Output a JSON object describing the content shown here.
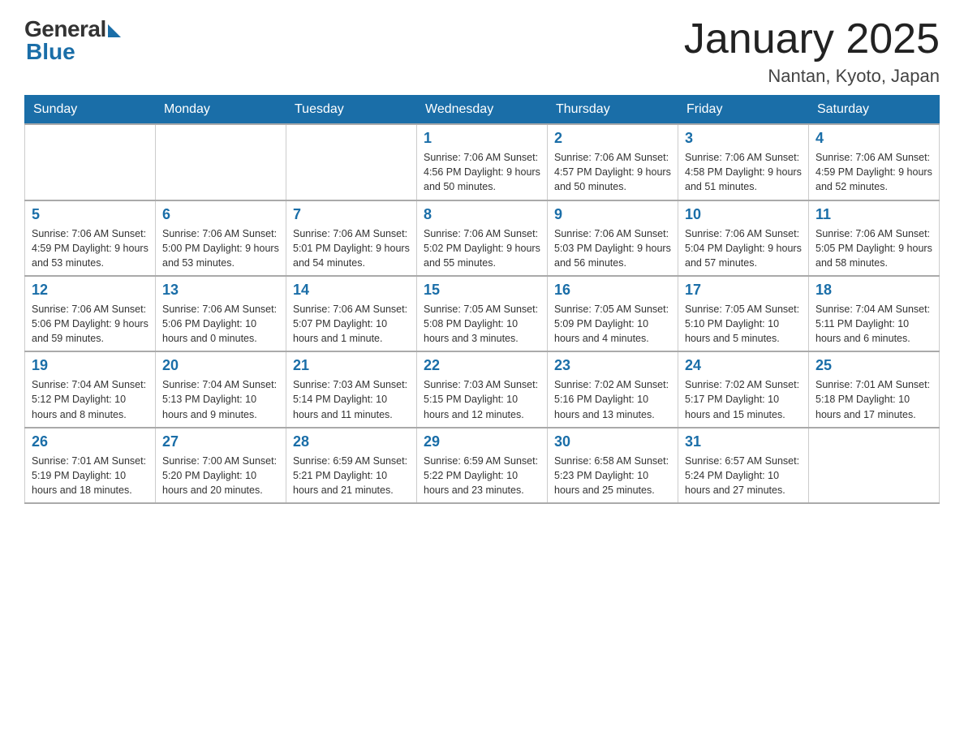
{
  "logo": {
    "general": "General",
    "blue": "Blue"
  },
  "header": {
    "month": "January 2025",
    "location": "Nantan, Kyoto, Japan"
  },
  "days_of_week": [
    "Sunday",
    "Monday",
    "Tuesday",
    "Wednesday",
    "Thursday",
    "Friday",
    "Saturday"
  ],
  "weeks": [
    [
      {
        "day": "",
        "info": ""
      },
      {
        "day": "",
        "info": ""
      },
      {
        "day": "",
        "info": ""
      },
      {
        "day": "1",
        "info": "Sunrise: 7:06 AM\nSunset: 4:56 PM\nDaylight: 9 hours\nand 50 minutes."
      },
      {
        "day": "2",
        "info": "Sunrise: 7:06 AM\nSunset: 4:57 PM\nDaylight: 9 hours\nand 50 minutes."
      },
      {
        "day": "3",
        "info": "Sunrise: 7:06 AM\nSunset: 4:58 PM\nDaylight: 9 hours\nand 51 minutes."
      },
      {
        "day": "4",
        "info": "Sunrise: 7:06 AM\nSunset: 4:59 PM\nDaylight: 9 hours\nand 52 minutes."
      }
    ],
    [
      {
        "day": "5",
        "info": "Sunrise: 7:06 AM\nSunset: 4:59 PM\nDaylight: 9 hours\nand 53 minutes."
      },
      {
        "day": "6",
        "info": "Sunrise: 7:06 AM\nSunset: 5:00 PM\nDaylight: 9 hours\nand 53 minutes."
      },
      {
        "day": "7",
        "info": "Sunrise: 7:06 AM\nSunset: 5:01 PM\nDaylight: 9 hours\nand 54 minutes."
      },
      {
        "day": "8",
        "info": "Sunrise: 7:06 AM\nSunset: 5:02 PM\nDaylight: 9 hours\nand 55 minutes."
      },
      {
        "day": "9",
        "info": "Sunrise: 7:06 AM\nSunset: 5:03 PM\nDaylight: 9 hours\nand 56 minutes."
      },
      {
        "day": "10",
        "info": "Sunrise: 7:06 AM\nSunset: 5:04 PM\nDaylight: 9 hours\nand 57 minutes."
      },
      {
        "day": "11",
        "info": "Sunrise: 7:06 AM\nSunset: 5:05 PM\nDaylight: 9 hours\nand 58 minutes."
      }
    ],
    [
      {
        "day": "12",
        "info": "Sunrise: 7:06 AM\nSunset: 5:06 PM\nDaylight: 9 hours\nand 59 minutes."
      },
      {
        "day": "13",
        "info": "Sunrise: 7:06 AM\nSunset: 5:06 PM\nDaylight: 10 hours\nand 0 minutes."
      },
      {
        "day": "14",
        "info": "Sunrise: 7:06 AM\nSunset: 5:07 PM\nDaylight: 10 hours\nand 1 minute."
      },
      {
        "day": "15",
        "info": "Sunrise: 7:05 AM\nSunset: 5:08 PM\nDaylight: 10 hours\nand 3 minutes."
      },
      {
        "day": "16",
        "info": "Sunrise: 7:05 AM\nSunset: 5:09 PM\nDaylight: 10 hours\nand 4 minutes."
      },
      {
        "day": "17",
        "info": "Sunrise: 7:05 AM\nSunset: 5:10 PM\nDaylight: 10 hours\nand 5 minutes."
      },
      {
        "day": "18",
        "info": "Sunrise: 7:04 AM\nSunset: 5:11 PM\nDaylight: 10 hours\nand 6 minutes."
      }
    ],
    [
      {
        "day": "19",
        "info": "Sunrise: 7:04 AM\nSunset: 5:12 PM\nDaylight: 10 hours\nand 8 minutes."
      },
      {
        "day": "20",
        "info": "Sunrise: 7:04 AM\nSunset: 5:13 PM\nDaylight: 10 hours\nand 9 minutes."
      },
      {
        "day": "21",
        "info": "Sunrise: 7:03 AM\nSunset: 5:14 PM\nDaylight: 10 hours\nand 11 minutes."
      },
      {
        "day": "22",
        "info": "Sunrise: 7:03 AM\nSunset: 5:15 PM\nDaylight: 10 hours\nand 12 minutes."
      },
      {
        "day": "23",
        "info": "Sunrise: 7:02 AM\nSunset: 5:16 PM\nDaylight: 10 hours\nand 13 minutes."
      },
      {
        "day": "24",
        "info": "Sunrise: 7:02 AM\nSunset: 5:17 PM\nDaylight: 10 hours\nand 15 minutes."
      },
      {
        "day": "25",
        "info": "Sunrise: 7:01 AM\nSunset: 5:18 PM\nDaylight: 10 hours\nand 17 minutes."
      }
    ],
    [
      {
        "day": "26",
        "info": "Sunrise: 7:01 AM\nSunset: 5:19 PM\nDaylight: 10 hours\nand 18 minutes."
      },
      {
        "day": "27",
        "info": "Sunrise: 7:00 AM\nSunset: 5:20 PM\nDaylight: 10 hours\nand 20 minutes."
      },
      {
        "day": "28",
        "info": "Sunrise: 6:59 AM\nSunset: 5:21 PM\nDaylight: 10 hours\nand 21 minutes."
      },
      {
        "day": "29",
        "info": "Sunrise: 6:59 AM\nSunset: 5:22 PM\nDaylight: 10 hours\nand 23 minutes."
      },
      {
        "day": "30",
        "info": "Sunrise: 6:58 AM\nSunset: 5:23 PM\nDaylight: 10 hours\nand 25 minutes."
      },
      {
        "day": "31",
        "info": "Sunrise: 6:57 AM\nSunset: 5:24 PM\nDaylight: 10 hours\nand 27 minutes."
      },
      {
        "day": "",
        "info": ""
      }
    ]
  ]
}
